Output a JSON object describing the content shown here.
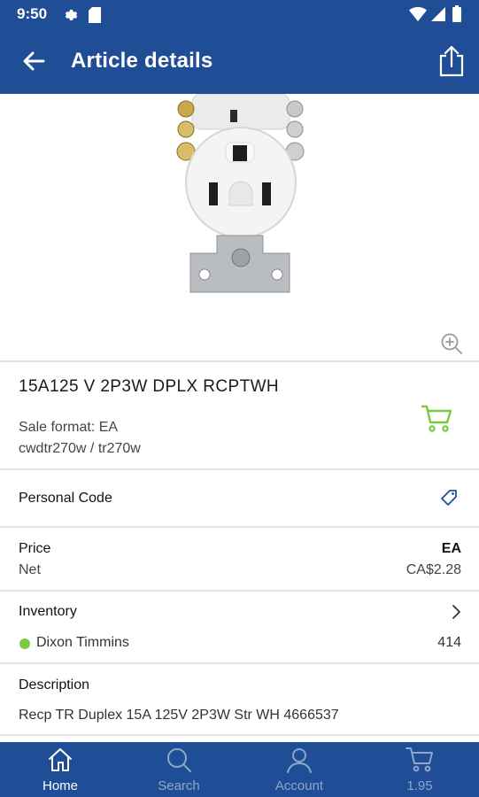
{
  "status_bar": {
    "time": "9:50"
  },
  "header": {
    "title": "Article details"
  },
  "product": {
    "title": "15A125 V 2P3W DPLX RCPTWH",
    "sale_format": "Sale format: EA",
    "codes": "cwdtr270w / tr270w"
  },
  "personal_code": {
    "label": "Personal Code"
  },
  "price": {
    "label": "Price",
    "unit": "EA",
    "net_label": "Net",
    "net_value": "CA$2.28"
  },
  "inventory": {
    "label": "Inventory",
    "location": "Dixon Timmins",
    "quantity": "414"
  },
  "description": {
    "label": "Description",
    "text": "Recp TR Duplex 15A 125V 2P3W Str WH 4666537"
  },
  "bottom_nav": {
    "home": "Home",
    "search": "Search",
    "account": "Account",
    "cart": "1.95"
  },
  "colors": {
    "brand": "#1f4e97",
    "accent_green": "#7ac943",
    "tag_blue": "#1f4e97"
  }
}
